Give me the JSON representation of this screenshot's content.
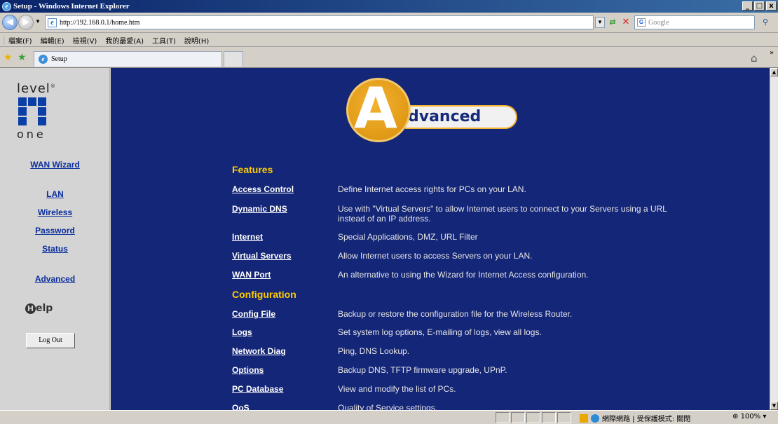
{
  "window": {
    "title": "Setup - Windows Internet Explorer",
    "controls": [
      "_",
      "□",
      "x"
    ]
  },
  "address": {
    "url": "http://192.168.0.1/home.htm",
    "search_placeholder": "Google"
  },
  "menu": [
    "檔案(F)",
    "編輯(E)",
    "檢視(V)",
    "我的最愛(A)",
    "工具(T)",
    "說明(H)"
  ],
  "tab": {
    "label": "Setup"
  },
  "sidebar": {
    "logo_top": "level",
    "logo_bottom": "one",
    "links": {
      "wan_wizard": "WAN Wizard",
      "lan": "LAN",
      "wireless": "Wireless",
      "password": "Password",
      "status": "Status",
      "advanced": "Advanced"
    },
    "help": "elp",
    "logout": "Log Out"
  },
  "banner": {
    "letter": "A",
    "rest": "dvanced"
  },
  "sections": {
    "features": "Features",
    "configuration": "Configuration"
  },
  "features": [
    {
      "name": "Access Control",
      "desc": "Define Internet access rights for PCs on your LAN."
    },
    {
      "name": "Dynamic DNS",
      "desc": "Use with \"Virtual Servers\" to allow Internet users to connect to your Servers using a URL instead of an IP address."
    },
    {
      "name": "Internet",
      "desc": "Special Applications, DMZ, URL Filter"
    },
    {
      "name": "Virtual Servers",
      "desc": "Allow Internet users to access Servers on your LAN."
    },
    {
      "name": "WAN Port",
      "desc": "An alternative to using the Wizard for Internet Access configuration."
    }
  ],
  "configuration": [
    {
      "name": "Config File",
      "desc": "Backup or restore the configuration file for the Wireless Router."
    },
    {
      "name": "Logs",
      "desc": "Set system log options, E-mailing of logs, view all logs."
    },
    {
      "name": "Network Diag",
      "desc": "Ping, DNS Lookup."
    },
    {
      "name": "Options",
      "desc": "Backup DNS, TFTP firmware upgrade, UPnP."
    },
    {
      "name": "PC Database",
      "desc": "View and modify the list of PCs."
    },
    {
      "name": "QoS",
      "desc": "Quality of Service settings."
    }
  ],
  "status": {
    "zone": "網際網路 | 受保護模式: 關閉",
    "zoom": "100%"
  }
}
